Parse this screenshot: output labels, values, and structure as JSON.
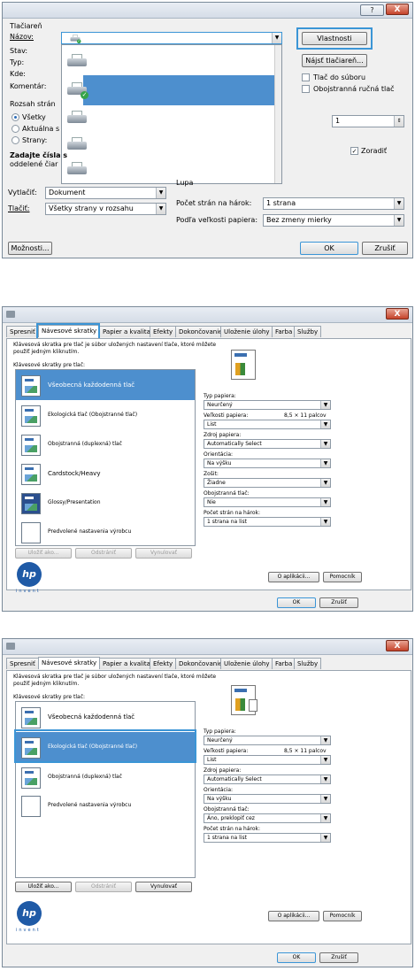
{
  "print_dialog": {
    "title_help": "?",
    "title_close": "X",
    "group_printer": "Tlačiareň",
    "name_label": "Názov:",
    "status_label": "Stav:",
    "type_label": "Typ:",
    "where_label": "Kde:",
    "comment_label": "Komentár:",
    "properties_button": "Vlastnosti",
    "find_printer_button": "Nájsť tlačiareň...",
    "print_to_file": "Tlač do súboru",
    "duplex_manual": "Obojstranná ručná tlač",
    "range_group": "Rozsah strán",
    "range_all": "Všetky",
    "range_current": "Aktuálna s",
    "range_pages": "Strany:",
    "range_hint1": "Zadajte čísla s",
    "range_hint2": "oddelené čiar",
    "copies_value": "1",
    "collate_label": "Zoradiť",
    "zoom_label": "Lupa",
    "pages_per_sheet_label": "Počet strán na hárok:",
    "pages_per_sheet_value": "1 strana",
    "scale_label": "Podľa veľkosti papiera:",
    "scale_value": "Bez zmeny mierky",
    "print_what_label": "Vytlačiť:",
    "print_what_value": "Dokument",
    "print_label": "Tlačiť:",
    "print_value": "Všetky strany v rozsahu",
    "options_button": "Možnosti...",
    "ok_button": "OK",
    "cancel_button": "Zrušiť",
    "printer_rows": 5
  },
  "properties_common": {
    "close": "X",
    "tabs": [
      "Spresniť",
      "Návesové skratky",
      "Papier a kvalita",
      "Efekty",
      "Dokončovanie",
      "Uloženie úlohy",
      "Farba",
      "Služby"
    ],
    "description": "Klávesová skratka pre tlač je súbor uložených nastavení tlače, ktoré môžete použiť jedným kliknutím.",
    "list_label": "Klávesové skratky pre tlač:",
    "paper_type_label": "Typ papiera:",
    "paper_type_value": "Neurčený",
    "paper_size_label": "Veľkosti papiera:",
    "paper_size_dims": "8,5 × 11 palcov",
    "paper_size_value": "List",
    "paper_source_label": "Zdroj papiera:",
    "paper_source_value": "Automatically Select",
    "orientation_label": "Orientácia:",
    "orientation_value": "Na výšku",
    "pages_per_sheet_label": "Počet strán na hárok:",
    "pages_per_sheet_value": "1 strana na list",
    "save_as_button": "Uložiť ako...",
    "delete_button": "Odstrániť",
    "reset_button": "Vynulovať",
    "about_button": "O aplikácii...",
    "help_button": "Pomocník",
    "ok_button": "OK",
    "cancel_button": "Zrušiť",
    "hp_logo": "hp",
    "invent": "invent"
  },
  "properties_1": {
    "shortcuts": [
      "Všeobecná každodenná tlač",
      "Ekologická tlač (Obojstranné tlač)",
      "Obojstranná (duplexná) tlač",
      "Cardstock/Heavy",
      "Glossy/Presentation",
      "Predvolené nastavenia výrobcu"
    ],
    "booklet_label": "Zošit:",
    "booklet_value": "Žiadne",
    "duplex_label": "Obojstranná tlač:",
    "duplex_value": "Nie"
  },
  "properties_2": {
    "shortcuts": [
      "Všeobecná každodenná tlač",
      "Ekologická tlač (Obojstranné tlač)",
      "Obojstranná (duplexná) tlač",
      "Predvolené nastavenia výrobcu"
    ],
    "duplex_label": "Obojstranná tlač:",
    "duplex_value": "Áno, preklopiť cez"
  }
}
